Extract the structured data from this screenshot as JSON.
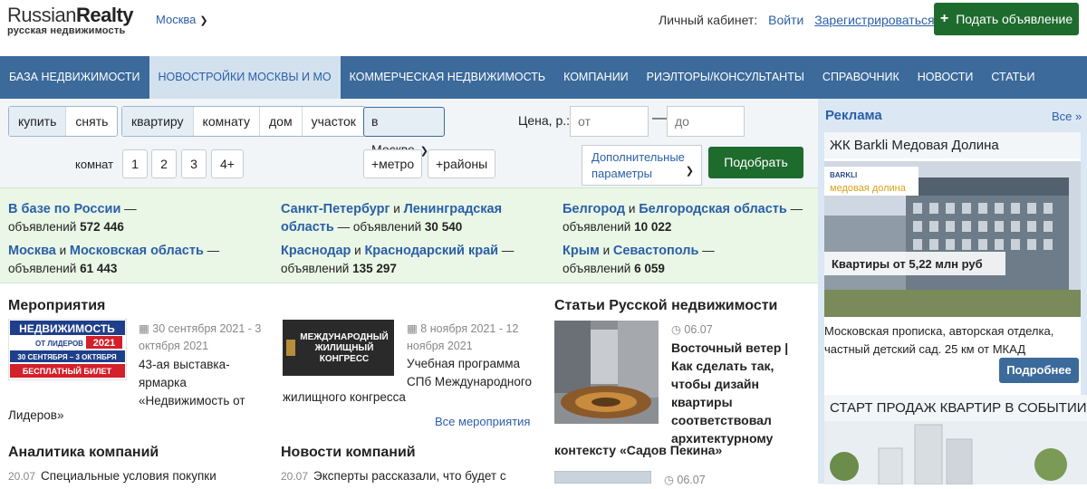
{
  "logo": {
    "main_light": "Russian",
    "main_bold": "Realty",
    "sub": "русская недвижимость"
  },
  "city": "Москва",
  "cabinet": {
    "label": "Личный кабинет:",
    "login": "Войти",
    "register": "Зарегистрироваться"
  },
  "post_button": "Подать объявление",
  "nav": [
    {
      "label": "БАЗА НЕДВИЖИМОСТИ",
      "active": false
    },
    {
      "label": "НОВОСТРОЙКИ МОСКВЫ И МО",
      "active": true
    },
    {
      "label": "КОММЕРЧЕСКАЯ НЕДВИЖИМОСТЬ",
      "active": false
    },
    {
      "label": "КОМПАНИИ",
      "active": false
    },
    {
      "label": "РИЭЛТОРЫ/КОНСУЛЬТАНТЫ",
      "active": false
    },
    {
      "label": "СПРАВОЧНИК",
      "active": false
    },
    {
      "label": "НОВОСТИ",
      "active": false
    },
    {
      "label": "СТАТЬИ",
      "active": false
    }
  ],
  "search": {
    "deal": [
      "купить",
      "снять"
    ],
    "object": [
      "квартиру",
      "комнату",
      "дом",
      "участок"
    ],
    "location": "в Москве",
    "price_label": "Цена, р.:",
    "price_from_placeholder": "от",
    "price_to_placeholder": "до",
    "rooms_label": "комнат",
    "rooms": [
      "1",
      "2",
      "3",
      "4+"
    ],
    "metro": "+метро",
    "districts": "+районы",
    "more_params_line1": "Дополнительные",
    "more_params_line2": "параметры",
    "find": "Подобрать"
  },
  "regions": {
    "russia": {
      "name": "В базе по России",
      "suffix": " —",
      "label": "объявлений",
      "count": "572 446"
    },
    "moscow": {
      "a": "Москва",
      "and": " и ",
      "b": "Московская область",
      "suffix": " —",
      "label": "объявлений",
      "count": "61 443"
    },
    "spb": {
      "a": "Санкт-Петербург",
      "and": " и ",
      "b": "Ленинградская",
      "b2": "область",
      "suffix": " — ",
      "label": "объявлений",
      "count": "30 540"
    },
    "krasnodar": {
      "a": "Краснодар",
      "and": " и ",
      "b": "Краснодарский край",
      "suffix": " —",
      "label": "объявлений",
      "count": "135 297"
    },
    "belgorod": {
      "a": "Белгород",
      "and": " и ",
      "b": "Белгородская область",
      "suffix": " —",
      "label": "объявлений",
      "count": "10 022"
    },
    "crimea": {
      "a": "Крым",
      "and": " и ",
      "b": "Севастополь",
      "suffix": " —",
      "label": "объявлений",
      "count": "6 059"
    }
  },
  "events": {
    "title": "Мероприятия",
    "e1": {
      "img_line1": "НЕДВИЖИМОСТЬ",
      "img_line2": "ОТ ЛИДЕРОВ",
      "img_year": "2021",
      "img_dates": "30 СЕНТЯБРЯ – 3 ОКТЯБРЯ",
      "img_free": "БЕСПЛАТНЫЙ БИЛЕТ",
      "date1": "30 сентября 2021 - 3",
      "date2": "октября 2021",
      "desc1": "43-ая выставка-",
      "desc2": "ярмарка",
      "desc3": "«Недвижимость от",
      "desc4": "Лидеров»"
    },
    "e2": {
      "img_line1": "МЕЖДУНАРОДНЫЙ",
      "img_line2": "ЖИЛИЩНЫЙ",
      "img_line3": "КОНГРЕСС",
      "date1": "8 ноября 2021 - 12",
      "date2": "ноября 2021",
      "desc1": "Учебная программа",
      "desc2": "СПб Международного",
      "desc3": "жилищного конгресса"
    },
    "all": "Все мероприятия"
  },
  "analytics": {
    "title": "Аналитика компаний",
    "date": "20.07",
    "text": "Специальные условия покупки"
  },
  "company_news": {
    "title": "Новости компаний",
    "date": "20.07",
    "text": "Эксперты рассказали, что будет с"
  },
  "articles": {
    "title": "Статьи Русской недвижимости",
    "a1": {
      "date": "06.07",
      "lines": [
        "Восточный ветер |",
        "Как сделать так,",
        "чтобы дизайн",
        "квартиры",
        "соответствовал",
        "архитектурному",
        "контексту «Садов Пекина»"
      ]
    },
    "a2": {
      "date": "06.07"
    }
  },
  "ads": {
    "title": "Реклама",
    "all": "Все »",
    "ad1": {
      "head": "ЖК Barkli Медовая Долина",
      "brand": "BARKLI",
      "brand_sub": "медовая долина",
      "price": "Квартиры от 5,22 млн руб",
      "text1": "Московская прописка, авторская отделка,",
      "text2": "частный детский сад. 25 км от МКАД",
      "button": "Подробнее"
    },
    "ad2": {
      "head": "СТАРТ ПРОДАЖ КВАРТИР В СОБЫТИИ"
    }
  }
}
